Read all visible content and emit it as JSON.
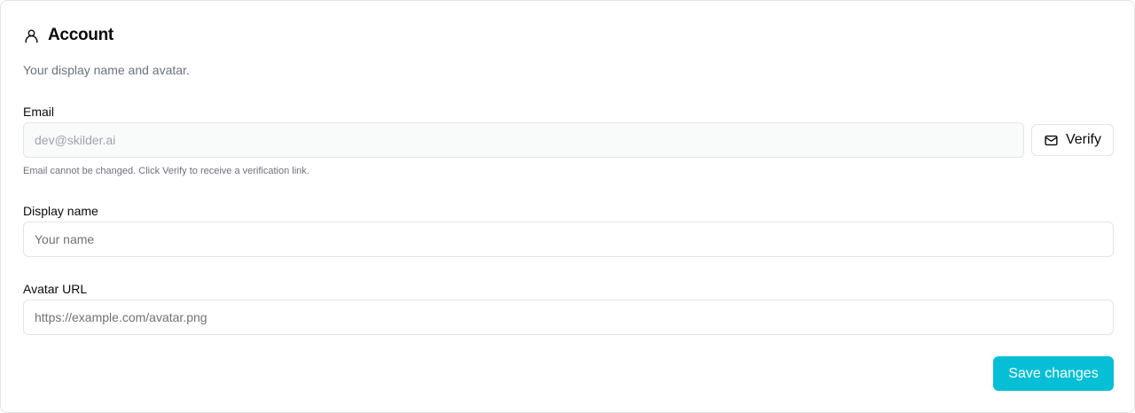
{
  "header": {
    "icon": "user-icon",
    "title": "Account",
    "subtitle": "Your display name and avatar."
  },
  "email": {
    "label": "Email",
    "value": "dev@skilder.ai",
    "hint": "Email cannot be changed. Click Verify to receive a verification link.",
    "verify_icon": "mail-icon",
    "verify_label": "Verify"
  },
  "display_name": {
    "label": "Display name",
    "value": "",
    "placeholder": "Your name"
  },
  "avatar_url": {
    "label": "Avatar URL",
    "value": "",
    "placeholder": "https://example.com/avatar.png"
  },
  "actions": {
    "save_label": "Save changes"
  },
  "colors": {
    "accent": "#06bfd6",
    "border": "#e4e4e7",
    "muted_text": "#6b7280"
  }
}
